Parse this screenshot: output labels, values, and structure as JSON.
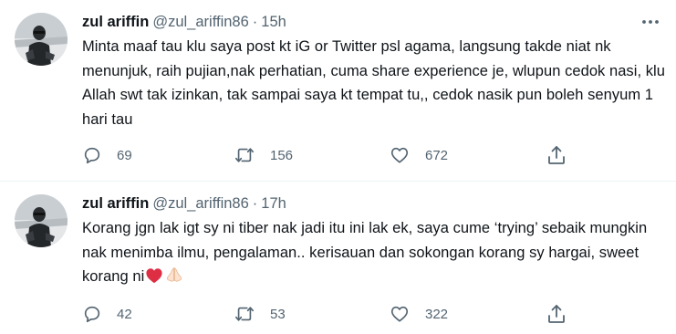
{
  "tweets": [
    {
      "author_name": "zul ariffin",
      "handle": "@zul_ariffin86",
      "separator": "·",
      "time": "15h",
      "text": "Minta maaf tau klu saya post kt iG or Twitter psl agama, langsung takde niat nk menunjuk, raih pujian,nak perhatian, cuma share experience je, wlupun cedok nasi, klu Allah swt tak izinkan, tak sampai saya kt tempat tu,, cedok nasik pun boleh senyum 1 hari tau",
      "replies": "69",
      "retweets": "156",
      "likes": "672"
    },
    {
      "author_name": "zul ariffin",
      "handle": "@zul_ariffin86",
      "separator": "·",
      "time": "17h",
      "text": "Korang jgn lak igt sy ni tiber nak jadi itu ini lak ek, saya cume ‘trying’ sebaik mungkin nak menimba ilmu, pengalaman.. kerisauan dan sokongan korang sy hargai, sweet korang ni",
      "emojis": [
        "red-heart-icon",
        "folded-hands-icon"
      ],
      "replies": "42",
      "retweets": "53",
      "likes": "322"
    }
  ],
  "icons": {
    "reply": "reply-icon",
    "retweet": "retweet-icon",
    "like": "like-icon",
    "share": "share-icon",
    "more": "more-options-icon"
  },
  "colors": {
    "text_primary": "#0f1419",
    "text_secondary": "#536471",
    "divider": "#eff3f4",
    "heart": "#e0245e"
  }
}
